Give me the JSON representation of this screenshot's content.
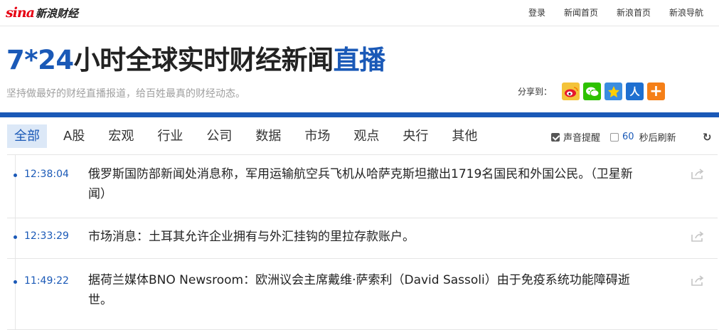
{
  "logo": {
    "mark": "sina",
    "text": "新浪财经"
  },
  "top_links": [
    "登录",
    "新闻首页",
    "新浪首页",
    "新浪导航"
  ],
  "headline": {
    "part1": "7*24",
    "part2": "小时全球实时财经新闻",
    "part3": "直播"
  },
  "subline": "坚持做最好的财经直播报道，给百姓最真的财经动态。",
  "share": {
    "label": "分享到：",
    "icons": [
      "weibo-icon",
      "wechat-icon",
      "qzone-icon",
      "renren-icon",
      "more-icon"
    ]
  },
  "tabs": [
    "全部",
    "A股",
    "宏观",
    "行业",
    "公司",
    "数据",
    "市场",
    "观点",
    "央行",
    "其他"
  ],
  "options": {
    "sound_label": "声音提醒",
    "refresh_seconds": "60",
    "refresh_label": "秒后刷新"
  },
  "feed": [
    {
      "time": "12:38:04",
      "text": "俄罗斯国防部新闻处消息称，军用运输航空兵飞机从哈萨克斯坦撤出1719名国民和外国公民。（卫星新闻）"
    },
    {
      "time": "12:33:29",
      "text": "市场消息：土耳其允许企业拥有与外汇挂钩的里拉存款账户。"
    },
    {
      "time": "11:49:22",
      "text": "据荷兰媒体BNO Newsroom：欧洲议会主席戴维·萨索利（David Sassoli）由于免疫系统功能障碍逝世。"
    }
  ],
  "colors": {
    "brand_blue": "#1a59b7",
    "sina_red": "#e60012"
  }
}
